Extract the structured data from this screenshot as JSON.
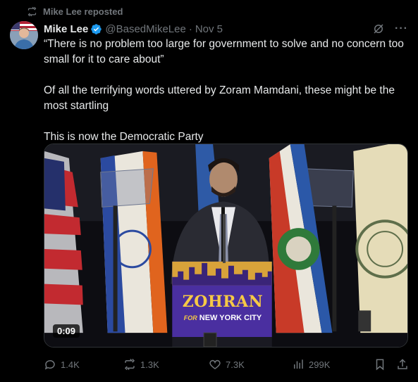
{
  "repost": {
    "label": "Mike Lee reposted",
    "icon": "repost-icon"
  },
  "author": {
    "name": "Mike Lee",
    "verified_icon": "verified-badge-icon",
    "handle": "@BasedMikeLee",
    "separator": "·",
    "date": "Nov 5"
  },
  "tweet": {
    "paragraphs": [
      "“There is no problem too large for government to solve and no concern too small for it to care about”",
      "Of all the terrifying words uttered by Zoram Mamdani, these might be the most startling",
      "This is now the Democratic Party"
    ]
  },
  "media": {
    "podium_title": "ZOHRAN",
    "podium_for": "FOR",
    "podium_city": "NEW YORK CITY",
    "duration": "0:09"
  },
  "actions": {
    "replies": "1.4K",
    "reposts": "1.3K",
    "likes": "7.3K",
    "views": "299K"
  },
  "colors": {
    "accent": "#1d9bf0",
    "muted": "#71767b",
    "background": "#000000",
    "text": "#e7e9ea"
  }
}
